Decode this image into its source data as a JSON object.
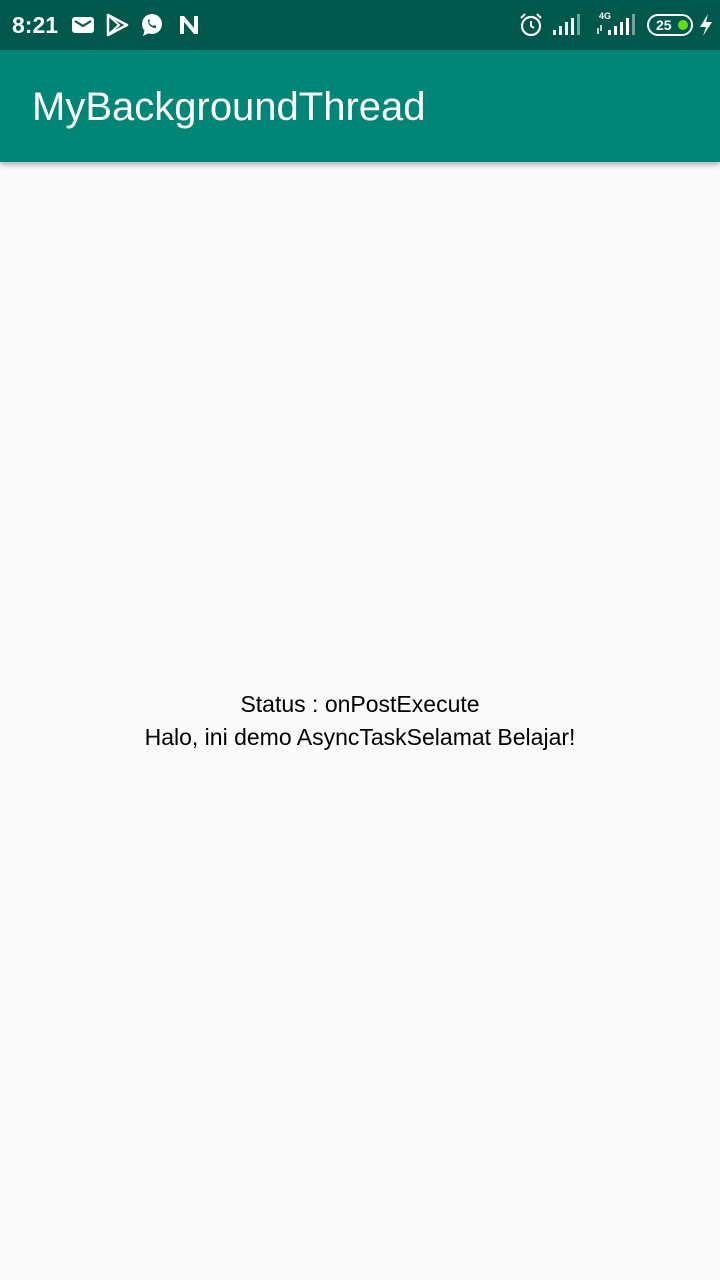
{
  "status_bar": {
    "time": "8:21",
    "icons": [
      "gmail-icon",
      "play-store-icon",
      "whatsapp-icon",
      "n-icon",
      "alarm-icon",
      "signal-icon",
      "signal-4g-icon",
      "charging-icon"
    ],
    "network_label": "4G",
    "battery_level": "25"
  },
  "app_bar": {
    "title": "MyBackgroundThread",
    "color": "#008577"
  },
  "main": {
    "status_line": "Status : onPostExecute",
    "message_line": "Halo, ini demo AsyncTaskSelamat Belajar!"
  }
}
